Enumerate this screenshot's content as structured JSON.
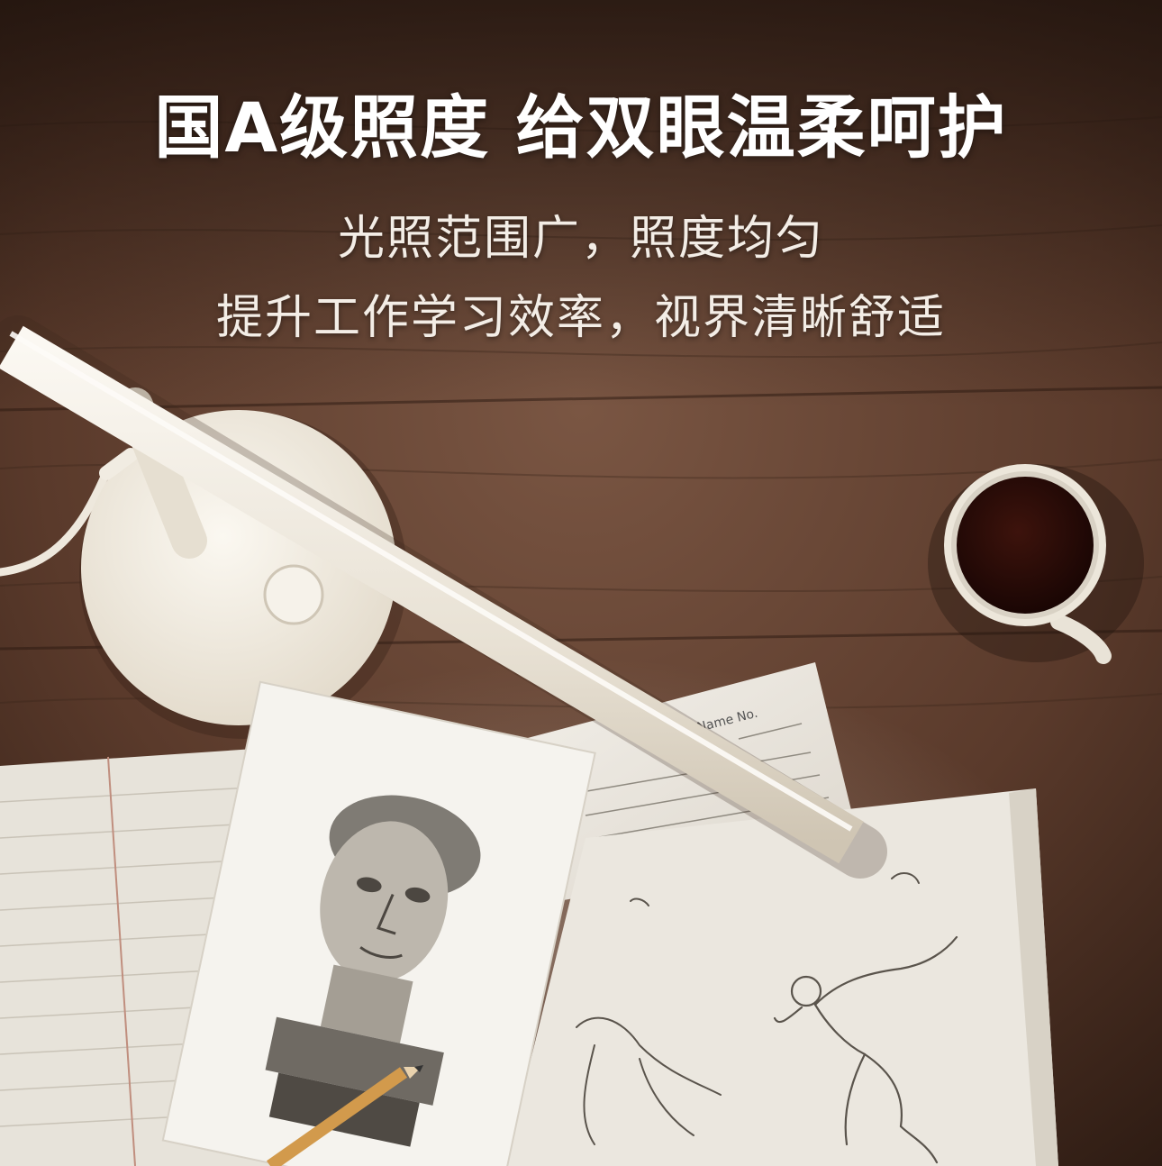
{
  "headline": "国A级照度 给双眼温柔呵护",
  "subline_1": "光照范围广，照度均匀",
  "subline_2": "提升工作学习效率，视界清晰舒适",
  "form_label": "Name No.",
  "colors": {
    "wood_dark": "#3b261c",
    "wood_mid": "#6e4c39",
    "lamp": "#f1ece2",
    "coffee": "#2a0c08"
  }
}
